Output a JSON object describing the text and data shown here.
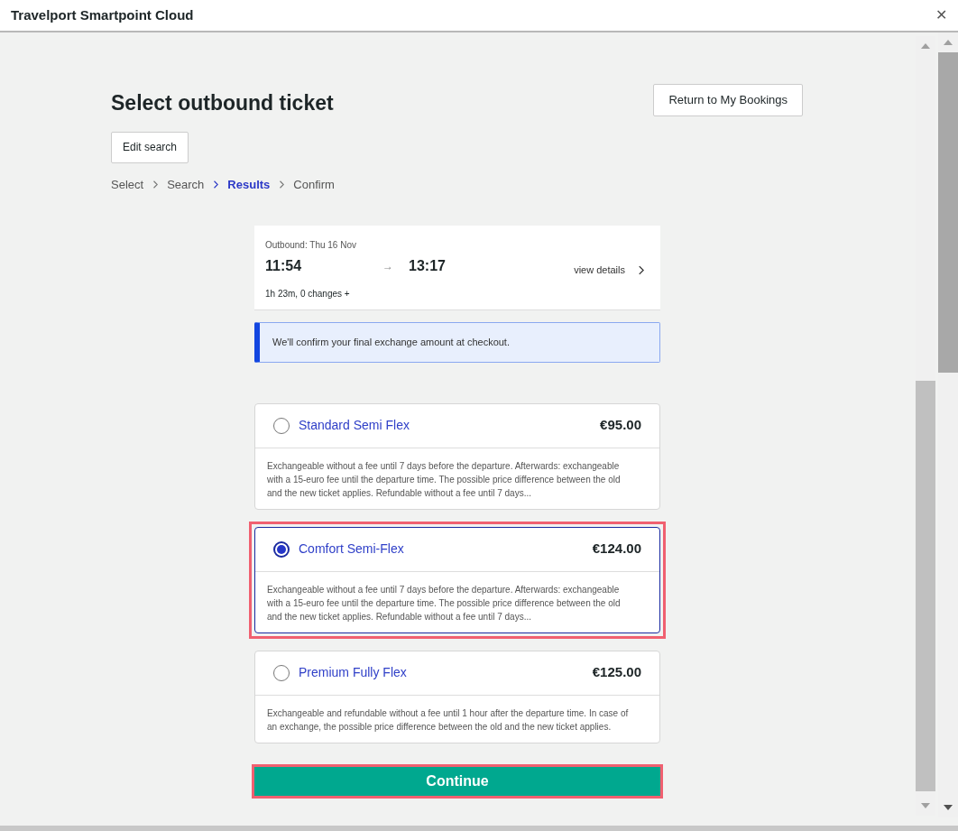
{
  "window": {
    "title": "Travelport Smartpoint Cloud",
    "close": "✕"
  },
  "header": {
    "title": "Select outbound ticket",
    "return_button": "Return to My Bookings",
    "edit_button": "Edit search"
  },
  "breadcrumb": [
    {
      "label": "Select",
      "selected": false
    },
    {
      "label": "Search",
      "selected": false
    },
    {
      "label": "Results",
      "selected": true
    },
    {
      "label": "Confirm",
      "selected": false
    }
  ],
  "journey": {
    "date": "Outbound: Thu 16 Nov",
    "departure": "11:54",
    "arrow": "→",
    "arrival": "13:17",
    "summary": "1h 23m, 0 changes +",
    "details_link": "view details"
  },
  "notice": "We'll confirm your final exchange amount at checkout.",
  "tickets": [
    {
      "name": "Standard Semi Flex",
      "price": "€95.00",
      "selected": false,
      "highlighted": false,
      "description": "Exchangeable without a fee until 7 days before the departure. Afterwards: exchangeable with a 15-euro fee until the departure time. The possible price difference between the old and the new ticket applies. Refundable without a fee until 7 days..."
    },
    {
      "name": "Comfort Semi-Flex",
      "price": "€124.00",
      "selected": true,
      "highlighted": true,
      "description": "Exchangeable without a fee until 7 days before the departure. Afterwards: exchangeable with a 15-euro fee until the departure time. The possible price difference between the old and the new ticket applies. Refundable without a fee until 7 days..."
    },
    {
      "name": "Premium Fully Flex",
      "price": "€125.00",
      "selected": false,
      "highlighted": false,
      "description": "Exchangeable and refundable without a fee until 1 hour after the departure time. In case of an exchange, the possible price difference between the old and the new ticket applies."
    }
  ],
  "continue_button": {
    "label": "Continue",
    "highlighted": true
  }
}
